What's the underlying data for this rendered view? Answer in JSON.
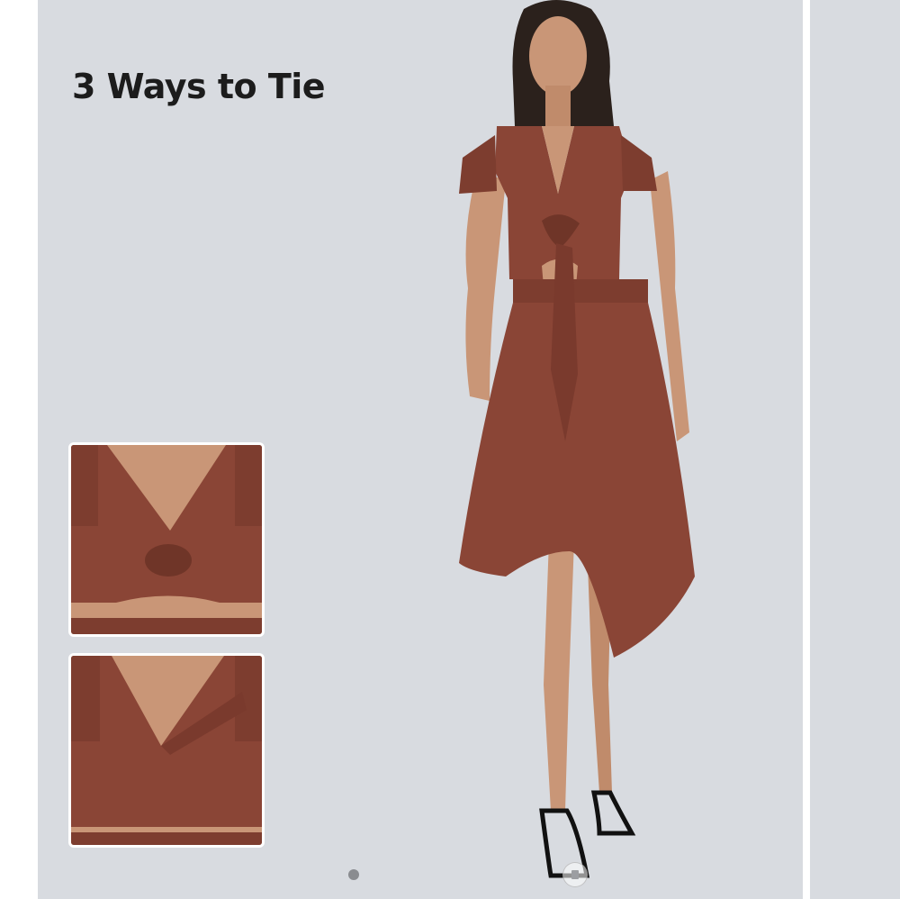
{
  "slide": {
    "title": "3 Ways to Tie"
  },
  "colors": {
    "background": "#d8dbe0",
    "dress": "#8a4536",
    "skin": "#c99677",
    "title_text": "#1c1c1c"
  },
  "thumbnails": [
    {
      "style": "twist-front"
    },
    {
      "style": "wrap-front"
    }
  ],
  "pagination": {
    "active_index": 1,
    "icons": [
      "dot-icon",
      "video-icon"
    ]
  }
}
